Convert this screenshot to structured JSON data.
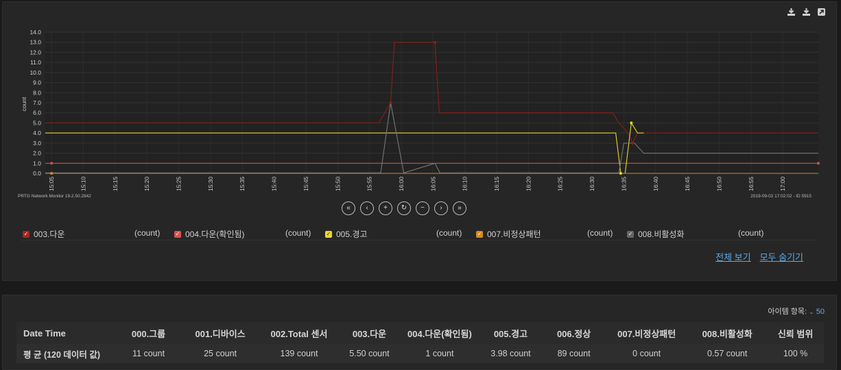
{
  "toolbar": {
    "icons": [
      "download-icon",
      "download-icon",
      "external-link-icon"
    ]
  },
  "chart_data": {
    "type": "line",
    "ylabel": "count",
    "ylim": [
      0,
      14
    ],
    "yticks": [
      "0.0",
      "1.0",
      "2.0",
      "3.0",
      "4.0",
      "5.0",
      "6.0",
      "7.0",
      "8.0",
      "9.0",
      "10.0",
      "11.0",
      "12.0",
      "13.0",
      "14.0"
    ],
    "xticks": [
      "15:05",
      "15:10",
      "15:15",
      "15:20",
      "15:25",
      "15:30",
      "15:35",
      "15:40",
      "15:45",
      "15:50",
      "15:55",
      "16:00",
      "16:05",
      "16:10",
      "16:15",
      "16:20",
      "16:25",
      "16:30",
      "16:35",
      "16:40",
      "16:45",
      "16:50",
      "16:55",
      "17:00"
    ],
    "grid": true,
    "series": [
      {
        "name": "003.다운",
        "color": "#8a1f1a",
        "points": [
          [
            0,
            5
          ],
          [
            53.5,
            5
          ],
          [
            55.4,
            7
          ],
          [
            56,
            13
          ],
          [
            62.5,
            13
          ],
          [
            63.2,
            6
          ],
          [
            91,
            6
          ],
          [
            92,
            5
          ],
          [
            93.5,
            4
          ],
          [
            94.2,
            3
          ],
          [
            95,
            4
          ],
          [
            124,
            4
          ]
        ]
      },
      {
        "name": "004.다운(확인됨)",
        "color": "#c9534f",
        "points": [
          [
            0,
            1
          ],
          [
            124,
            1
          ]
        ]
      },
      {
        "name": "005.경고",
        "color": "#e8d82b",
        "points": [
          [
            0,
            4
          ],
          [
            91.5,
            4
          ],
          [
            92.3,
            0
          ],
          [
            93,
            0
          ],
          [
            94,
            5
          ],
          [
            95,
            4
          ],
          [
            96,
            4
          ]
        ]
      },
      {
        "name": "007.비정상패턴",
        "color": "#d98a1c",
        "points": [
          [
            0,
            0
          ],
          [
            124,
            0
          ]
        ]
      },
      {
        "name": "008.비활성화",
        "color": "#777777",
        "points": [
          [
            0,
            0.05
          ],
          [
            53.8,
            0.05
          ],
          [
            55.4,
            7
          ],
          [
            57.5,
            0.05
          ],
          [
            62.5,
            1
          ],
          [
            63.3,
            0.05
          ],
          [
            92,
            0.05
          ],
          [
            92.8,
            3
          ],
          [
            94.5,
            3
          ],
          [
            96,
            2
          ],
          [
            124,
            2
          ]
        ]
      }
    ],
    "markers": [
      {
        "series": "003.다운",
        "points": [
          [
            55.4,
            7
          ],
          [
            62.5,
            13
          ],
          [
            94.2,
            3
          ]
        ]
      },
      {
        "series": "004.다운(확인됨)",
        "points": [
          [
            1,
            1
          ],
          [
            124,
            1
          ]
        ]
      },
      {
        "series": "005.경고",
        "points": [
          [
            92.3,
            0
          ],
          [
            94,
            5
          ]
        ]
      },
      {
        "series": "007.비정상패턴",
        "points": [
          [
            1,
            0
          ]
        ]
      }
    ]
  },
  "chart_footer": {
    "left": "PRTG Network Monitor 19.2.50.2842",
    "right": "2019-09-02 17:02:02 - ID 5915"
  },
  "nav": [
    "«",
    "‹",
    "+",
    "↻",
    "−",
    "›",
    "»"
  ],
  "legend": {
    "items": [
      {
        "label": "003.다운",
        "unit": "(count)",
        "color": "#a8261f"
      },
      {
        "label": "004.다운(확인됨)",
        "unit": "(count)",
        "color": "#d9534f"
      },
      {
        "label": "005.경고",
        "unit": "(count)",
        "color": "#e8d82b"
      },
      {
        "label": "007.비정상패턴",
        "unit": "(count)",
        "color": "#d98a1c"
      },
      {
        "label": "008.비활성화",
        "unit": "(count)",
        "color": "#666666"
      }
    ]
  },
  "links": {
    "show_all": "전체 보기",
    "hide_all": "모두 숨기기"
  },
  "table": {
    "items_label": "아이템 항목:",
    "items_value": "50",
    "headers": [
      "Date Time",
      "000.그룹",
      "001.디바이스",
      "002.Total 센서",
      "003.다운",
      "004.다운(확인됨)",
      "005.경고",
      "006.정상",
      "007.비정상패턴",
      "008.비활성화",
      "신뢰 범위"
    ],
    "avg_row": [
      "평 균 (120 데이터 값)",
      "11 count",
      "25 count",
      "139 count",
      "5.50 count",
      "1 count",
      "3.98 count",
      "89 count",
      "0 count",
      "0.57 count",
      "100 %"
    ]
  }
}
